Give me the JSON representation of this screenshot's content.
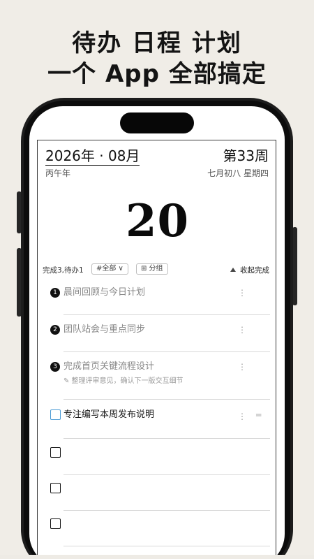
{
  "hero": {
    "line1": "待办 日程 计划",
    "line2": "一个 App 全部搞定"
  },
  "calendar": {
    "year_month": "2026年 · 08月",
    "week": "第33周",
    "ganzhi": "丙午年",
    "lunar_weekday": "七月初八  星期四",
    "day": "20"
  },
  "toolbar": {
    "stats": "完成3,待办1",
    "filter_label": "#全部 ∨",
    "group_label": "⊞ 分组",
    "collapse_label": "收起完成"
  },
  "tasks": [
    {
      "num": "1",
      "title": "晨间回顾与今日计划",
      "more": "⋮"
    },
    {
      "num": "2",
      "title": "团队站会与重点同步",
      "more": "⋮"
    },
    {
      "num": "3",
      "title": "完成首页关键流程设计",
      "note": "✎ 整理评审意见，确认下一版交互细节",
      "more": "⋮"
    },
    {
      "title": "专注编写本周发布说明",
      "more": "⋮",
      "drag": "═"
    }
  ],
  "empty_rows": 3
}
